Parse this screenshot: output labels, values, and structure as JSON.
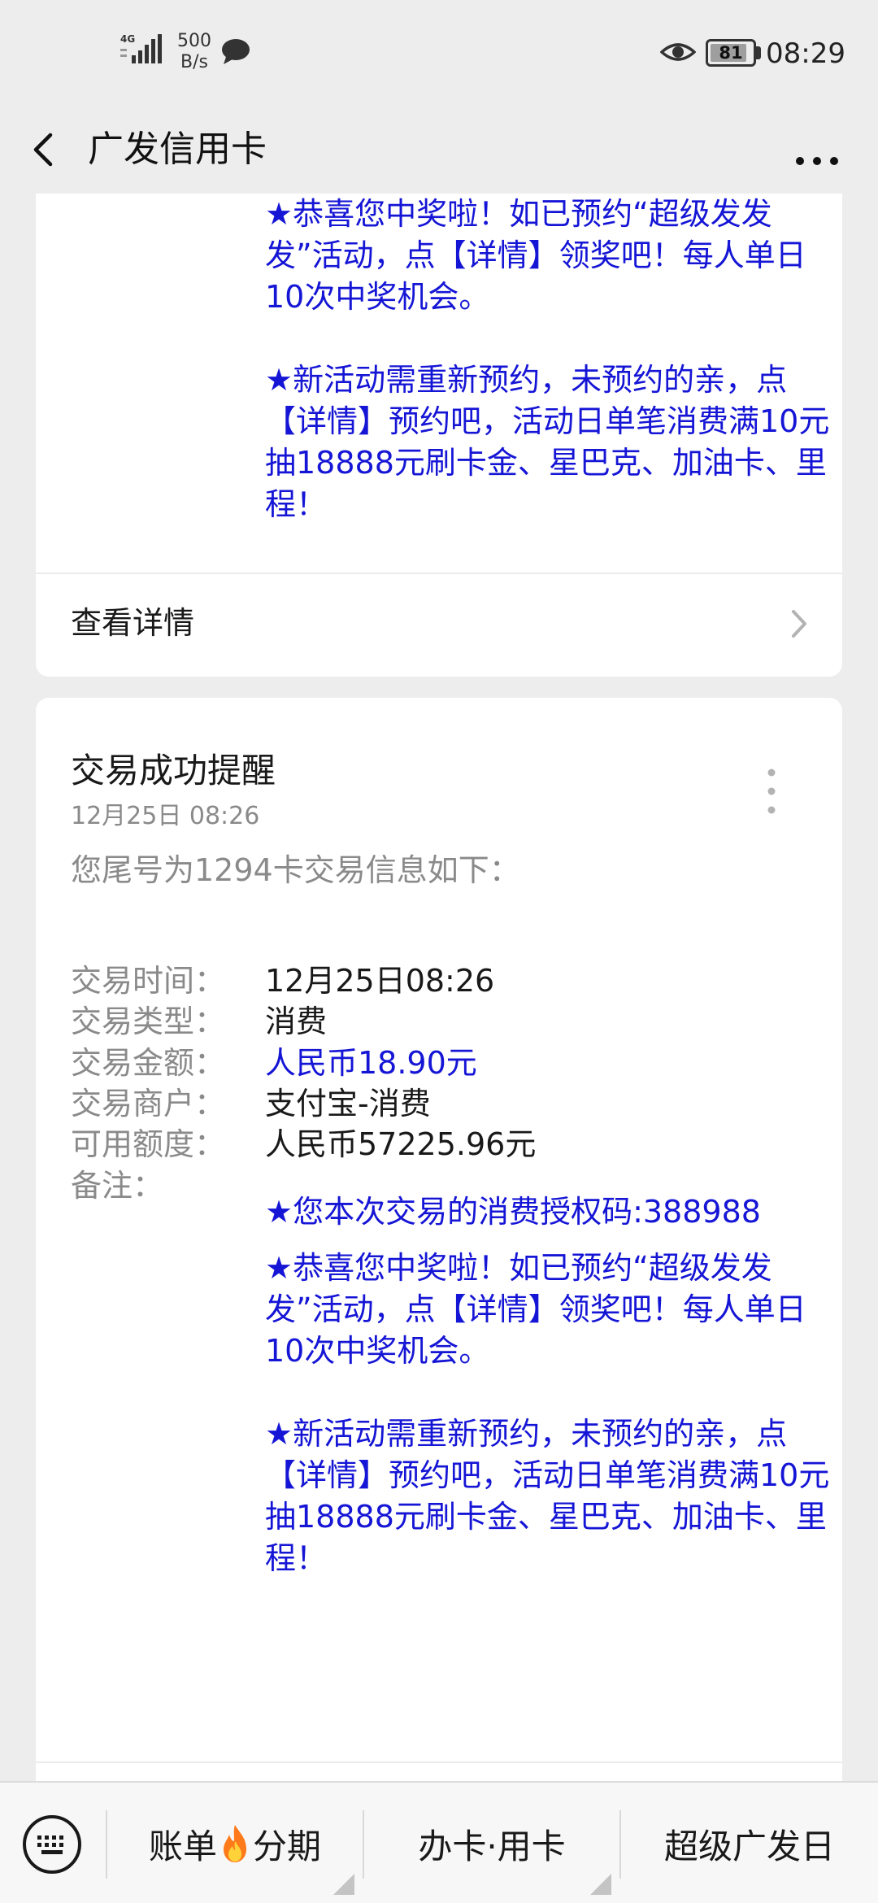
{
  "status_bar": {
    "network": "4G",
    "speed_value": "500",
    "speed_unit": "B/s",
    "battery": "81",
    "time": "08:29"
  },
  "nav": {
    "title": "广发信用卡"
  },
  "card1": {
    "para1": "★恭喜您中奖啦！如已预约“超级发发发”活动，点【详情】领奖吧！每人单日10次中奖机会。",
    "para2": "★新活动需重新预约，未预约的亲，点【详情】预约吧，活动日单笔消费满10元抽18888元刷卡金、星巴克、加油卡、里程！",
    "detail_label": "查看详情"
  },
  "card2": {
    "title": "交易成功提醒",
    "time": "12月25日  08:26",
    "intro": "您尾号为1294卡交易信息如下：",
    "rows": [
      {
        "label": "交易时间：",
        "value": "12月25日08:26"
      },
      {
        "label": "交易类型：",
        "value": "消费"
      },
      {
        "label": "交易金额：",
        "value": "人民币18.90元"
      },
      {
        "label": "交易商户：",
        "value": "支付宝-消费"
      },
      {
        "label": "可用额度：",
        "value": "人民币57225.96元"
      }
    ],
    "note_label": "备注：",
    "note1": "★您本次交易的消费授权码:388988",
    "note2": "★恭喜您中奖啦！如已预约“超级发发发”活动，点【详情】领奖吧！每人单日10次中奖机会。",
    "note3": "★新活动需重新预约，未预约的亲，点【详情】预约吧，活动日单笔消费满10元抽18888元刷卡金、星巴克、加油卡、里程！"
  },
  "bottom_menu": {
    "item1_a": "账单",
    "item1_b": "分期",
    "item2": "办卡·用卡",
    "item3": "超级广发日"
  },
  "colors": {
    "accent_blue": "#1515d6",
    "background": "#ededed"
  }
}
